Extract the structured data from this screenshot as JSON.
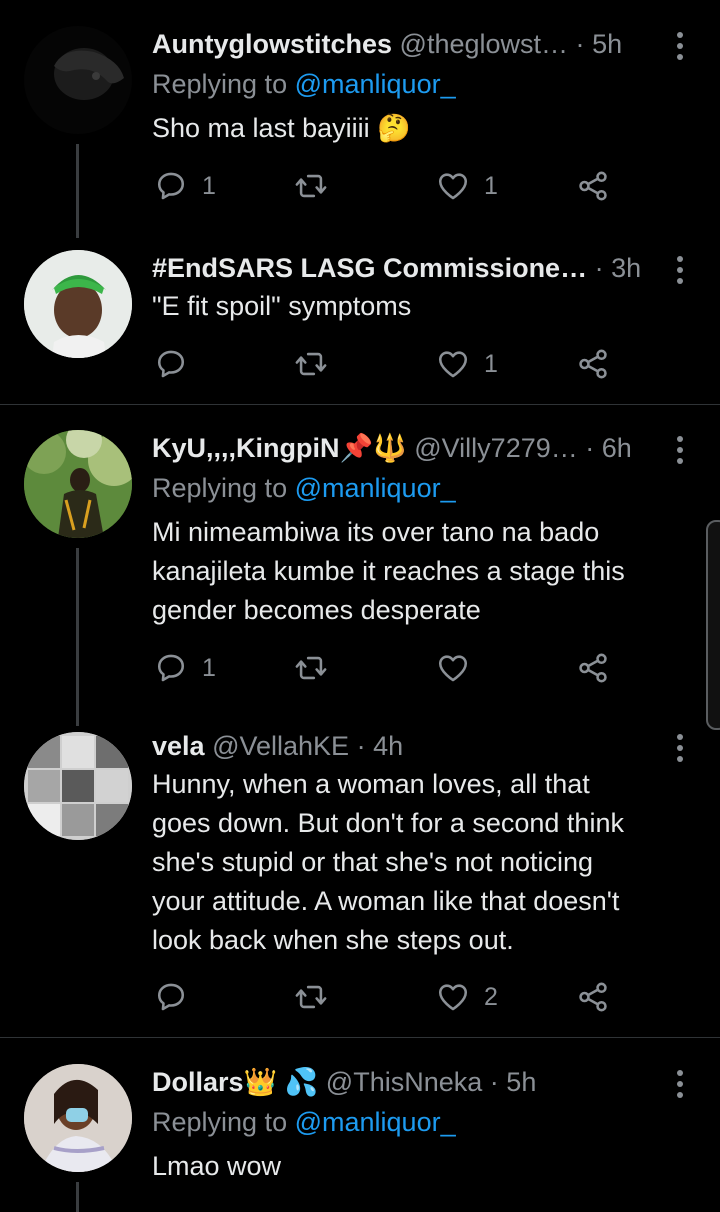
{
  "tweets": [
    {
      "name": "Auntyglowstitches",
      "handle": "@theglowst…",
      "time": "5h",
      "reply_label": "Replying to",
      "reply_to": "@manliquor_",
      "text": "Sho ma last bayiiii 🤔",
      "replies": "1",
      "retweets": "",
      "likes": "1"
    },
    {
      "name": "#EndSARS LASG Commissione…",
      "handle": "",
      "time": "3h",
      "text": "\"E fit spoil\" symptoms",
      "replies": "",
      "retweets": "",
      "likes": "1"
    },
    {
      "name": "KyU,,,,KingpiN📌🔱",
      "handle": "@Villy7279…",
      "time": "6h",
      "reply_label": "Replying to",
      "reply_to": "@manliquor_",
      "text_lines": [
        "Mi nimeambiwa its over tano na bado",
        "kanajileta kumbe it reaches a stage this",
        "gender becomes desperate"
      ],
      "replies": "1",
      "retweets": "",
      "likes": ""
    },
    {
      "name": "vela",
      "handle": "@VellahKE",
      "time": "4h",
      "text_lines": [
        "Hunny, when a woman loves, all that",
        "goes down. But don't for a second think",
        "she's stupid or that she's not noticing",
        "your attitude. A woman like that doesn't",
        "look back when she steps out."
      ],
      "replies": "",
      "retweets": "",
      "likes": "2"
    },
    {
      "name": "Dollars👑 💦",
      "handle": "@ThisNneka",
      "time": "5h",
      "reply_label": "Replying to",
      "reply_to": "@manliquor_",
      "text": "Lmao wow"
    }
  ],
  "separator": "·",
  "colors": {
    "background": "#000000",
    "text": "#e7e9ea",
    "muted": "#8b9096",
    "link": "#1d9bf0",
    "divider": "#2f3336"
  },
  "icons": [
    "reply-icon",
    "retweet-icon",
    "like-icon",
    "share-icon",
    "more-icon"
  ]
}
